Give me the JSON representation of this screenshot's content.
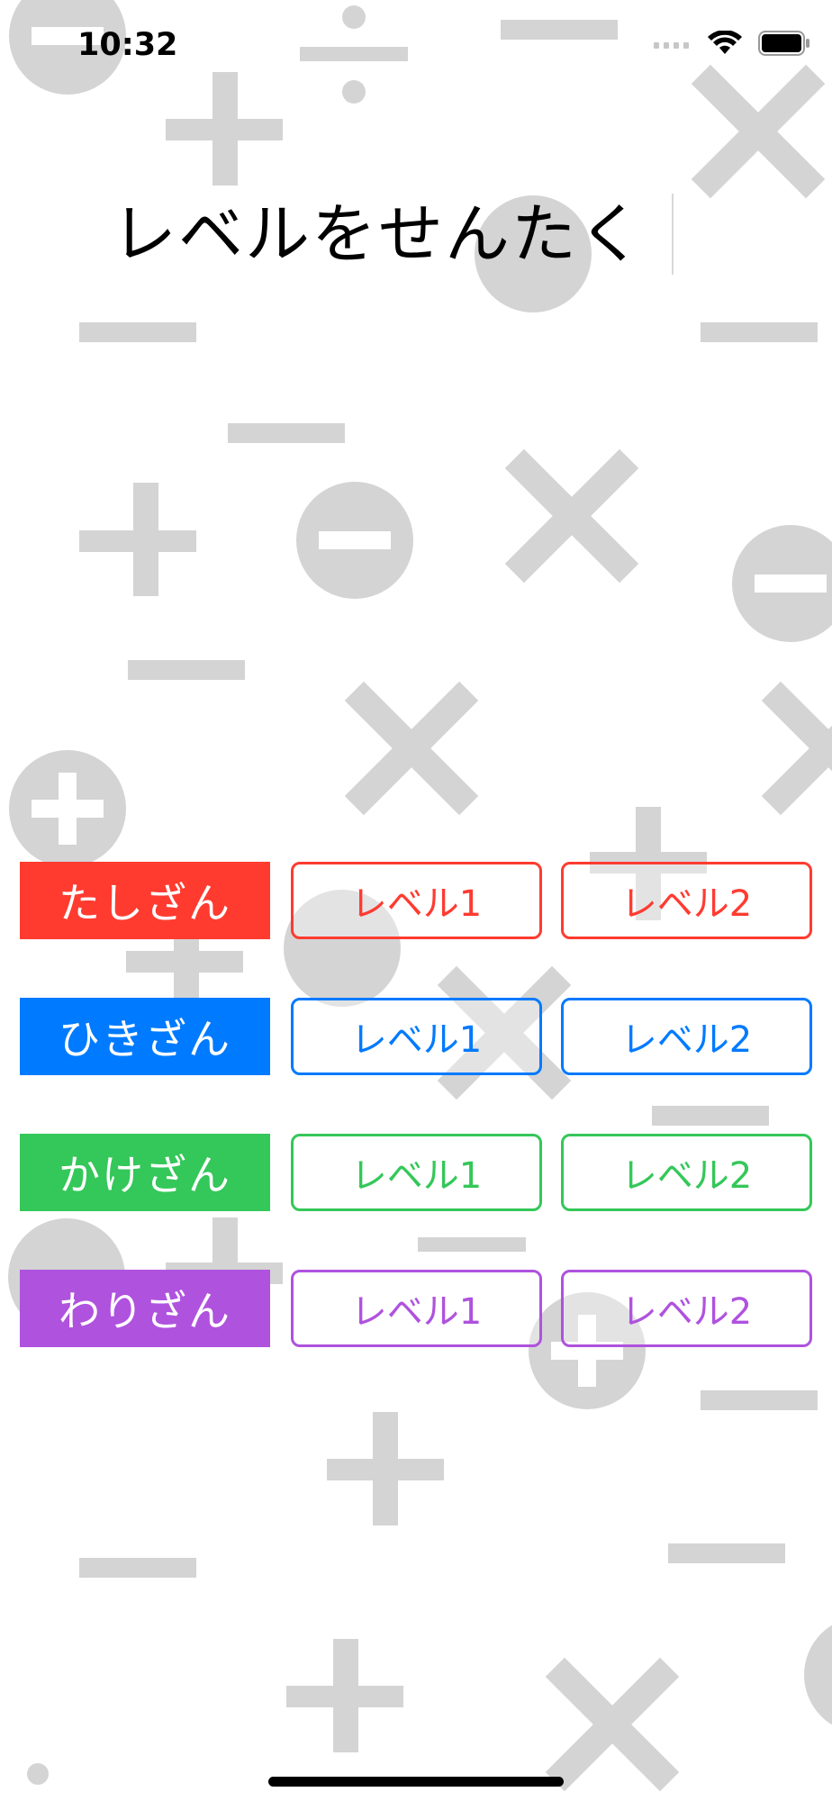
{
  "status_bar": {
    "time": "10:32",
    "icons": [
      "cellular-signal-icon",
      "wifi-icon",
      "battery-icon"
    ]
  },
  "header": {
    "title": "レベルをせんたく"
  },
  "operations": [
    {
      "label": "たしざん",
      "color": "#FF3B30",
      "level1": "レベル1",
      "level2": "レベル2"
    },
    {
      "label": "ひきざん",
      "color": "#007AFF",
      "level1": "レベル1",
      "level2": "レベル2"
    },
    {
      "label": "かけざん",
      "color": "#34C759",
      "level1": "レベル1",
      "level2": "レベル2"
    },
    {
      "label": "わりざん",
      "color": "#AF52DE",
      "level1": "レベル1",
      "level2": "レベル2"
    }
  ],
  "background": {
    "symbol_color": "#D4D4D4",
    "symbols": [
      "plus-icon",
      "minus-icon",
      "times-icon",
      "divide-icon",
      "circle-minus-icon",
      "circle-plus-icon",
      "circle-times-icon"
    ]
  }
}
